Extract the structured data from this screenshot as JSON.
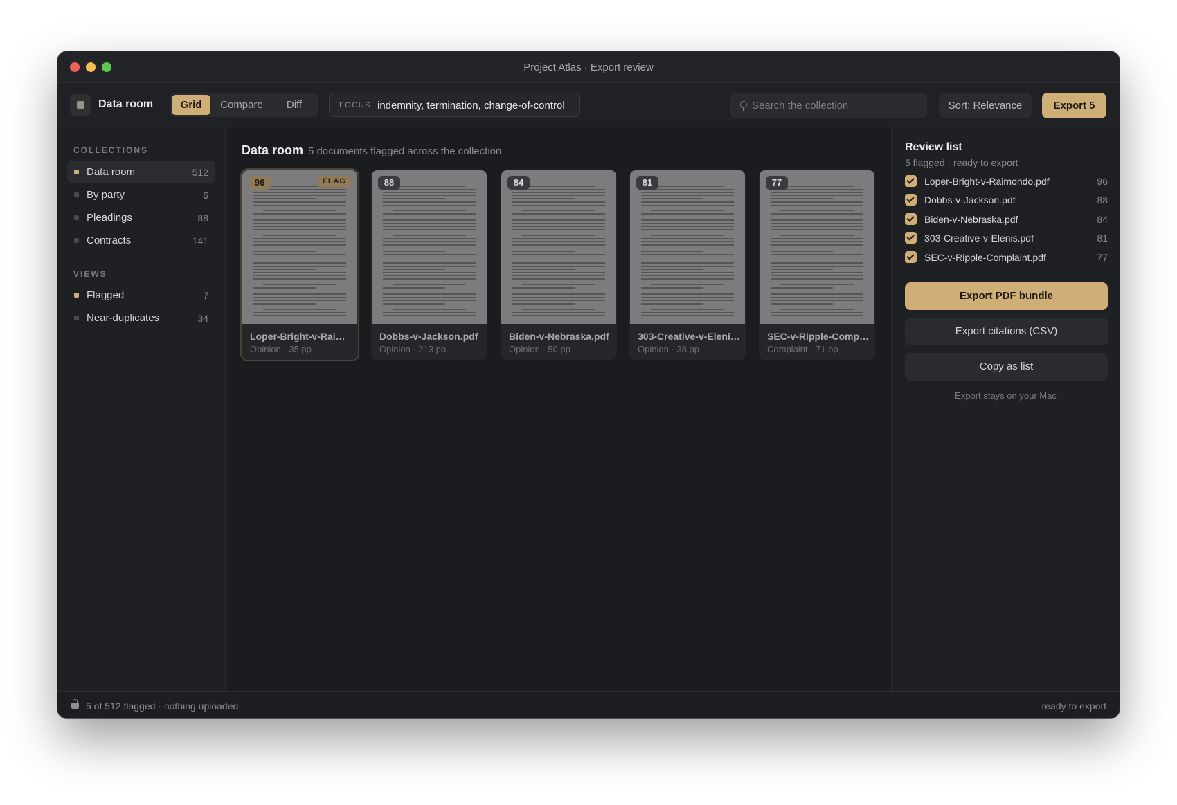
{
  "window": {
    "title": "Project Atlas · Export review"
  },
  "toolbar": {
    "app_name": "Data room",
    "view_tabs": [
      {
        "label": "Grid",
        "active": true
      },
      {
        "label": "Compare",
        "active": false
      },
      {
        "label": "Diff",
        "active": false
      }
    ],
    "focus_label": "FOCUS",
    "focus_terms": "indemnity, termination, change-of-control",
    "search_placeholder": "Search the collection",
    "sort_label": "Sort: Relevance",
    "export_label": "Export 5"
  },
  "sidebar": {
    "collections_heading": "COLLECTIONS",
    "collections": [
      {
        "label": "Data room",
        "count": "512",
        "active": true
      },
      {
        "label": "By party",
        "count": "6"
      },
      {
        "label": "Pleadings",
        "count": "88"
      },
      {
        "label": "Contracts",
        "count": "141"
      }
    ],
    "views_heading": "VIEWS",
    "views": [
      {
        "label": "Flagged",
        "count": "7"
      },
      {
        "label": "Near-duplicates",
        "count": "34"
      }
    ]
  },
  "main": {
    "title": "Data room",
    "subtitle": "5 documents flagged across the collection",
    "documents": [
      {
        "score": "96",
        "flag": "FLAG",
        "name": "Loper-Bright-v-Raimondo.pdf",
        "meta": "Opinion · 35 pp"
      },
      {
        "score": "88",
        "name": "Dobbs-v-Jackson.pdf",
        "meta": "Opinion · 213 pp"
      },
      {
        "score": "84",
        "name": "Biden-v-Nebraska.pdf",
        "meta": "Opinion · 50 pp"
      },
      {
        "score": "81",
        "name": "303-Creative-v-Elenis.pdf",
        "meta": "Opinion · 38 pp"
      },
      {
        "score": "77",
        "name": "SEC-v-Ripple-Complaint.pdf",
        "meta": "Complaint · 71 pp"
      }
    ]
  },
  "review": {
    "title": "Review list",
    "subtitle": "5 flagged · ready to export",
    "items": [
      {
        "name": "Loper-Bright-v-Raimondo.pdf",
        "score": "96"
      },
      {
        "name": "Dobbs-v-Jackson.pdf",
        "score": "88"
      },
      {
        "name": "Biden-v-Nebraska.pdf",
        "score": "84"
      },
      {
        "name": "303-Creative-v-Elenis.pdf",
        "score": "81"
      },
      {
        "name": "SEC-v-Ripple-Complaint.pdf",
        "score": "77"
      }
    ],
    "export_pdf_label": "Export PDF bundle",
    "export_csv_label": "Export citations (CSV)",
    "copy_label": "Copy as list",
    "footnote": "Export stays on your Mac"
  },
  "status": {
    "left": "5 of 512 flagged · nothing uploaded",
    "right": "ready to export"
  },
  "colors": {
    "accent": "#cfae77",
    "background": "#1b1c1f"
  },
  "icons": {
    "lock": "lock-icon",
    "search": "search-icon"
  }
}
